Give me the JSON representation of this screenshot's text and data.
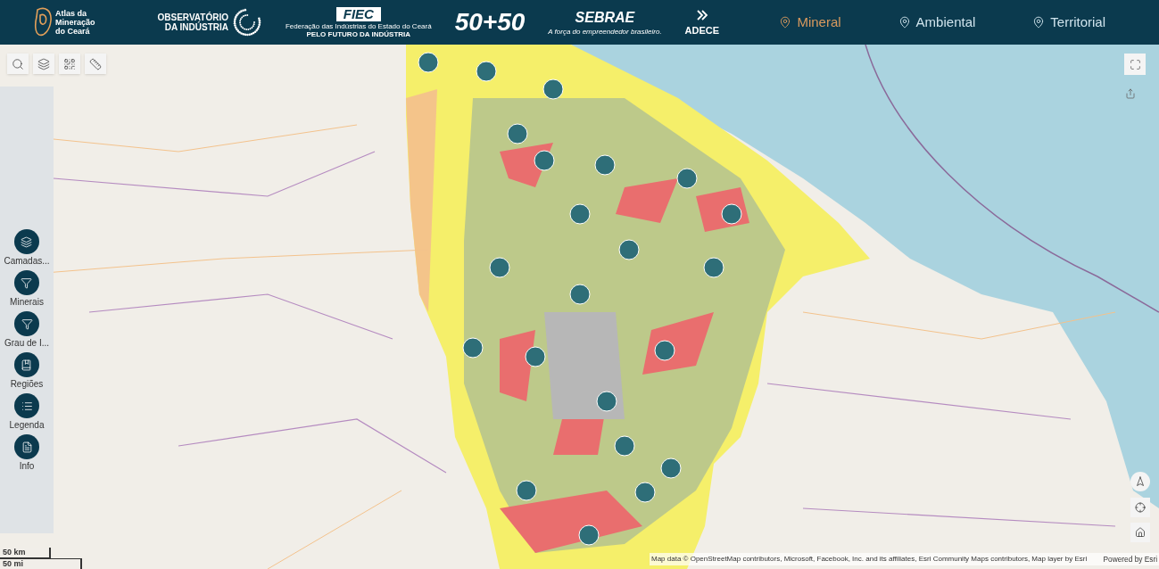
{
  "header": {
    "app_logo": {
      "lines": [
        "Atlas da",
        "Mineração",
        "do Ceará"
      ]
    },
    "partner_logos": [
      {
        "kind": "observatorio",
        "lines": [
          "OBSERVATÓRIO",
          "DA INDÚSTRIA"
        ]
      },
      {
        "kind": "fiec",
        "lines": [
          "FIEC",
          "Federação das Indústrias do Estado do Ceará",
          "PELO FUTURO DA INDÚSTRIA"
        ]
      },
      {
        "kind": "fifty",
        "lines": [
          "50+50"
        ]
      },
      {
        "kind": "sebrae",
        "lines": [
          "SEBRAE",
          "A força do empreendedor brasileiro."
        ]
      },
      {
        "kind": "adece",
        "lines": [
          "ADECE"
        ]
      }
    ],
    "tabs": [
      {
        "label": "Mineral",
        "selected": true
      },
      {
        "label": "Ambiental",
        "selected": false
      },
      {
        "label": "Territorial",
        "selected": false
      }
    ]
  },
  "map_tools": [
    {
      "kind": "search"
    },
    {
      "kind": "layers"
    },
    {
      "kind": "grid"
    },
    {
      "kind": "measure"
    }
  ],
  "side_panel": {
    "items": [
      {
        "kind": "layers",
        "label": "Camadas..."
      },
      {
        "kind": "filter",
        "label": "Minerais"
      },
      {
        "kind": "filter",
        "label": "Grau de I..."
      },
      {
        "kind": "bookmark",
        "label": "Regiões"
      },
      {
        "kind": "list",
        "label": "Legenda"
      },
      {
        "kind": "info",
        "label": "Info"
      }
    ]
  },
  "scale_bar": {
    "metric": "50 km",
    "imperial": "50 mi"
  },
  "attribution": {
    "text": "Map data © OpenStreetMap contributors, Microsoft, Facebook, Inc. and its affiliates, Esri Community Maps contributors, Map layer by Esri",
    "powered_by": "Powered by Esri"
  }
}
